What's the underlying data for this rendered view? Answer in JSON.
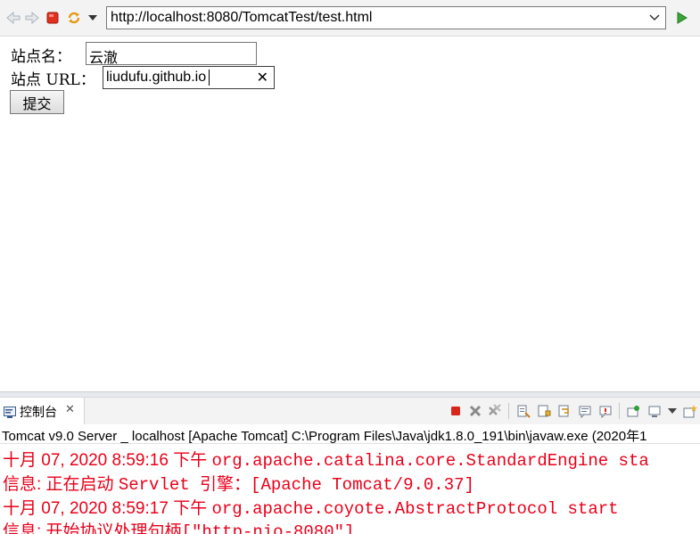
{
  "browser": {
    "url": "http://localhost:8080/TomcatTest/test.html"
  },
  "form": {
    "site_name_label": "站点名：",
    "site_name_value": "云澈",
    "site_url_label": "站点 URL：",
    "site_url_value": "liudufu.github.io",
    "clear_glyph": "✕",
    "submit_label": "提交"
  },
  "console": {
    "tab_label": "控制台",
    "tab_close": "✕",
    "title": "Tomcat v9.0 Server _ localhost [Apache Tomcat] C:\\Program Files\\Java\\jdk1.8.0_191\\bin\\javaw.exe  (2020年1",
    "lines": [
      {
        "prefix": "十月 07, 2020 8:59:16 下午 ",
        "body": "org.apache.catalina.core.StandardEngine sta"
      },
      {
        "prefix": "信息: 正在启动 ",
        "body": "Servlet 引擎：[Apache Tomcat/9.0.37]"
      },
      {
        "prefix": "十月 07, 2020 8:59:17 下午 ",
        "body": "org.apache.coyote.AbstractProtocol start"
      },
      {
        "prefix": "信息: 开始协议处理句柄",
        "body": "[\"http-nio-8080\"]"
      }
    ]
  },
  "colors": {
    "console_text": "#e8001a",
    "toolbar_bg": "#f3f3f3"
  }
}
